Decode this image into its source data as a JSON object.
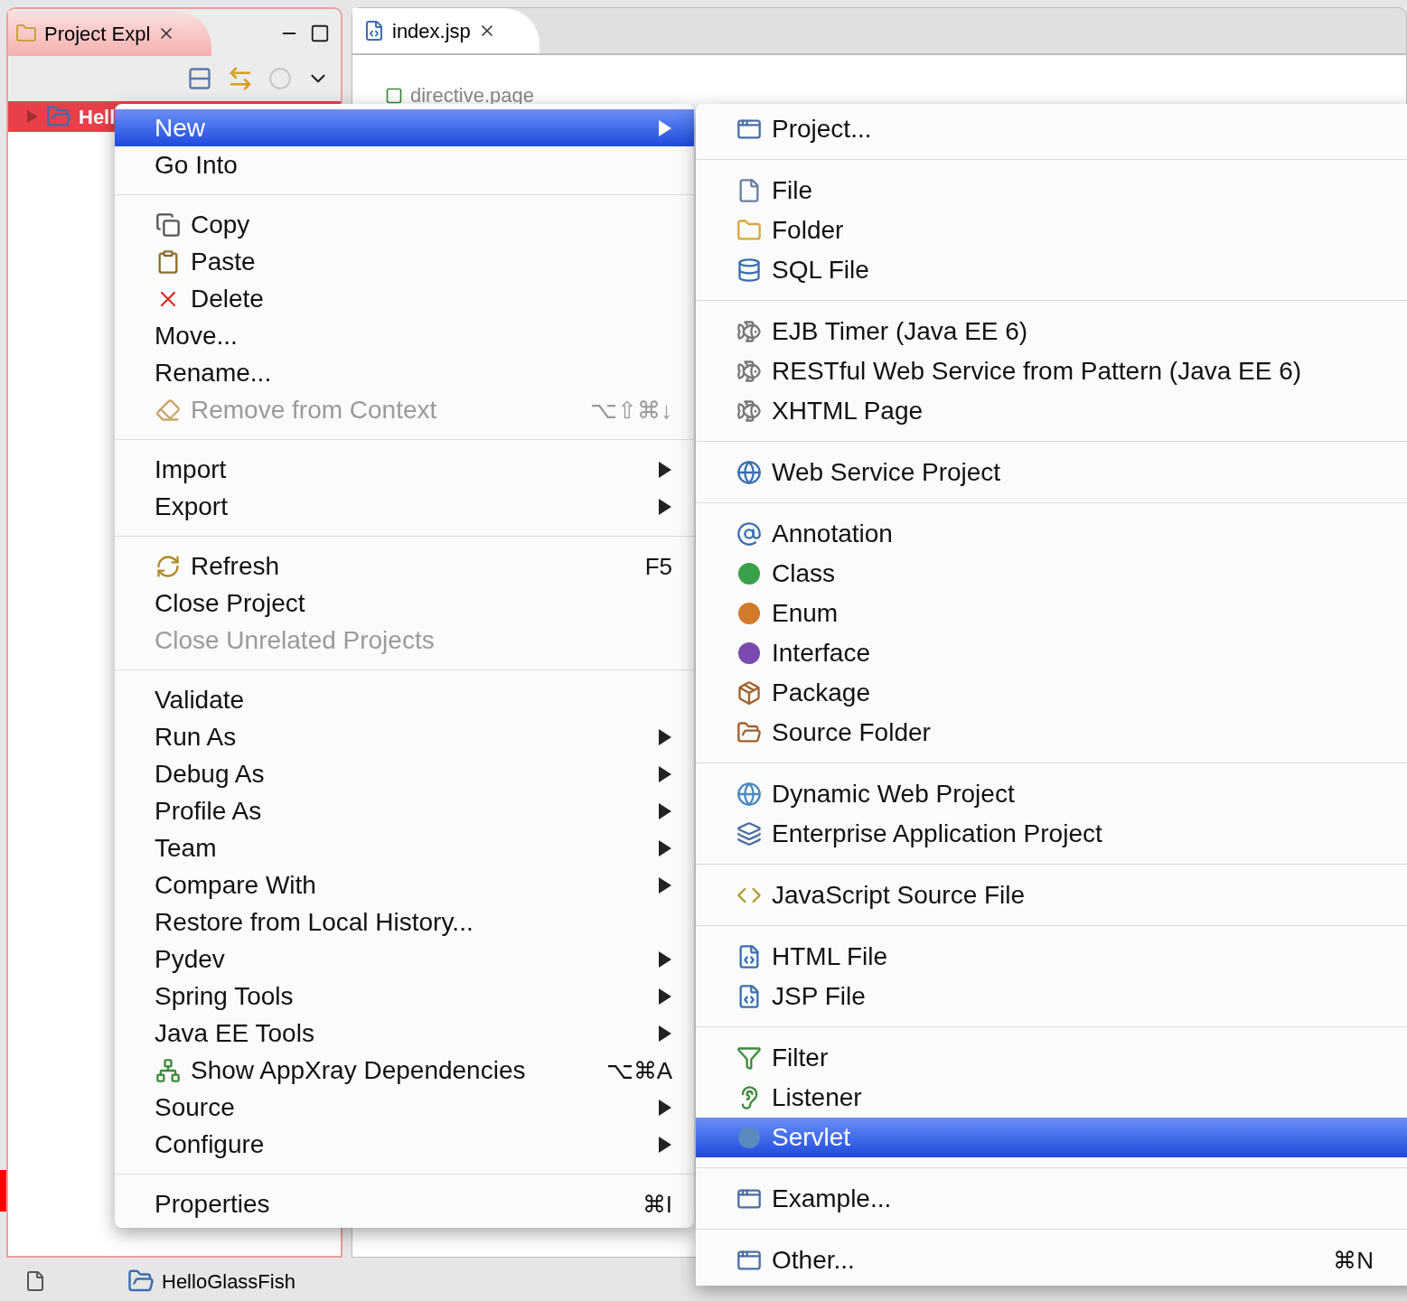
{
  "explorer": {
    "tab": {
      "label": "Project Expl",
      "selected": true
    },
    "tree": [
      {
        "label": "Hell",
        "selected": true,
        "expanded": false
      }
    ],
    "status": "HelloGlassFish"
  },
  "editor": {
    "tab": {
      "label": "index.jsp",
      "selected": true
    },
    "lines": [
      "directive.page"
    ]
  },
  "context_menu": {
    "groups": [
      [
        {
          "label": "New",
          "selected": true,
          "disabled": false,
          "submenu": true
        },
        {
          "label": "Go Into",
          "selected": false,
          "disabled": false,
          "submenu": false
        }
      ],
      [
        {
          "label": "Copy",
          "selected": false,
          "disabled": false,
          "submenu": false
        },
        {
          "label": "Paste",
          "selected": false,
          "disabled": false,
          "submenu": false
        },
        {
          "label": "Delete",
          "selected": false,
          "disabled": false,
          "submenu": false
        },
        {
          "label": "Move...",
          "selected": false,
          "disabled": false,
          "submenu": false
        },
        {
          "label": "Rename...",
          "selected": false,
          "disabled": false,
          "submenu": false
        },
        {
          "label": "Remove from Context",
          "selected": false,
          "disabled": true,
          "submenu": false,
          "shortcut": "⌥⇧⌘↓"
        }
      ],
      [
        {
          "label": "Import",
          "selected": false,
          "disabled": false,
          "submenu": true
        },
        {
          "label": "Export",
          "selected": false,
          "disabled": false,
          "submenu": true
        }
      ],
      [
        {
          "label": "Refresh",
          "selected": false,
          "disabled": false,
          "submenu": false,
          "shortcut": "F5"
        },
        {
          "label": "Close Project",
          "selected": false,
          "disabled": false,
          "submenu": false
        },
        {
          "label": "Close Unrelated Projects",
          "selected": false,
          "disabled": true,
          "submenu": false
        }
      ],
      [
        {
          "label": "Validate",
          "selected": false,
          "disabled": false,
          "submenu": false
        },
        {
          "label": "Run As",
          "selected": false,
          "disabled": false,
          "submenu": true
        },
        {
          "label": "Debug As",
          "selected": false,
          "disabled": false,
          "submenu": true
        },
        {
          "label": "Profile As",
          "selected": false,
          "disabled": false,
          "submenu": true
        },
        {
          "label": "Team",
          "selected": false,
          "disabled": false,
          "submenu": true
        },
        {
          "label": "Compare With",
          "selected": false,
          "disabled": false,
          "submenu": true
        },
        {
          "label": "Restore from Local History...",
          "selected": false,
          "disabled": false,
          "submenu": false
        },
        {
          "label": "Pydev",
          "selected": false,
          "disabled": false,
          "submenu": true
        },
        {
          "label": "Spring Tools",
          "selected": false,
          "disabled": false,
          "submenu": true
        },
        {
          "label": "Java EE Tools",
          "selected": false,
          "disabled": false,
          "submenu": true
        },
        {
          "label": "Show AppXray Dependencies",
          "selected": false,
          "disabled": false,
          "submenu": false,
          "shortcut": "⌥⌘A"
        },
        {
          "label": "Source",
          "selected": false,
          "disabled": false,
          "submenu": true
        },
        {
          "label": "Configure",
          "selected": false,
          "disabled": false,
          "submenu": true
        }
      ],
      [
        {
          "label": "Properties",
          "selected": false,
          "disabled": false,
          "submenu": false,
          "shortcut": "⌘I"
        }
      ]
    ]
  },
  "submenu": {
    "groups": [
      [
        {
          "label": "Project...",
          "selected": false
        }
      ],
      [
        {
          "label": "File",
          "selected": false
        },
        {
          "label": "Folder",
          "selected": false
        },
        {
          "label": "SQL File",
          "selected": false
        }
      ],
      [
        {
          "label": "EJB Timer (Java EE 6)",
          "selected": false
        },
        {
          "label": "RESTful Web Service from Pattern (Java EE 6)",
          "selected": false
        },
        {
          "label": "XHTML Page",
          "selected": false
        }
      ],
      [
        {
          "label": "Web Service Project",
          "selected": false
        }
      ],
      [
        {
          "label": "Annotation",
          "selected": false
        },
        {
          "label": "Class",
          "selected": false
        },
        {
          "label": "Enum",
          "selected": false
        },
        {
          "label": "Interface",
          "selected": false
        },
        {
          "label": "Package",
          "selected": false
        },
        {
          "label": "Source Folder",
          "selected": false
        }
      ],
      [
        {
          "label": "Dynamic Web Project",
          "selected": false
        },
        {
          "label": "Enterprise Application Project",
          "selected": false
        }
      ],
      [
        {
          "label": "JavaScript Source File",
          "selected": false
        }
      ],
      [
        {
          "label": "HTML File",
          "selected": false
        },
        {
          "label": "JSP File",
          "selected": false
        }
      ],
      [
        {
          "label": "Filter",
          "selected": false
        },
        {
          "label": "Listener",
          "selected": false
        },
        {
          "label": "Servlet",
          "selected": true
        }
      ],
      [
        {
          "label": "Example...",
          "selected": false
        }
      ],
      [
        {
          "label": "Other...",
          "selected": false,
          "shortcut": "⌘N"
        }
      ]
    ]
  }
}
